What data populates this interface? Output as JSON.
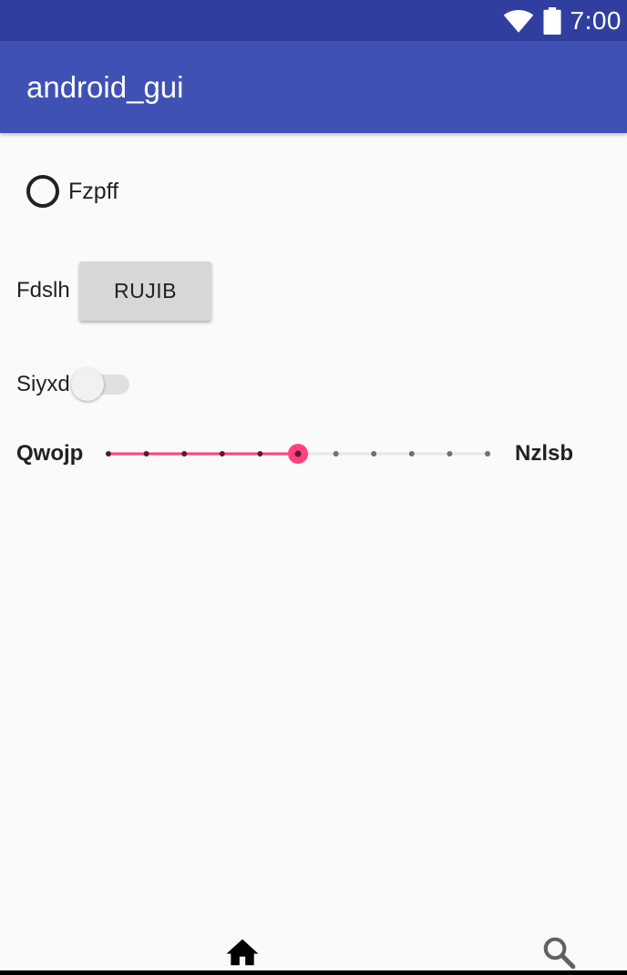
{
  "status_bar": {
    "time": "7:00",
    "icons": [
      "wifi-icon",
      "battery-icon"
    ],
    "color": "#303f9f"
  },
  "app_bar": {
    "title": "android_gui",
    "color": "#3f51b5"
  },
  "radio": {
    "label": "Fzpff",
    "checked": false
  },
  "button_row": {
    "label": "Fdslh",
    "button_label": "RUJIB"
  },
  "switch_row": {
    "label": "Siyxd",
    "on": false
  },
  "slider_row": {
    "left_label": "Qwojp",
    "right_label": "Nzlsb",
    "min": 0,
    "max": 10,
    "value": 5,
    "accent": "#ff4081"
  },
  "bottom_nav": {
    "items": [
      "home-icon",
      "search-icon"
    ]
  }
}
